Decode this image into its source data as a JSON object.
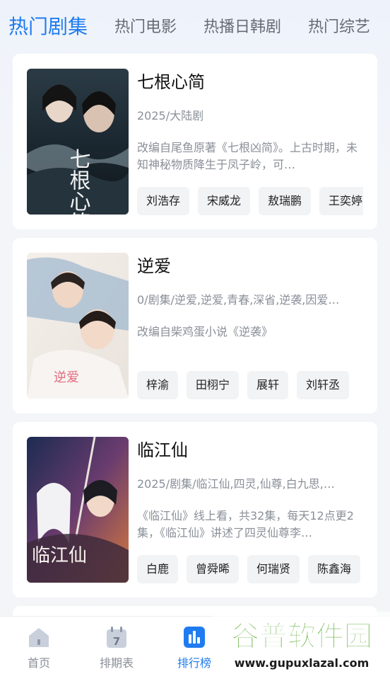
{
  "tabs": [
    {
      "label": "热门剧集",
      "active": true
    },
    {
      "label": "热门电影",
      "active": false
    },
    {
      "label": "热播日韩剧",
      "active": false
    },
    {
      "label": "热门综艺",
      "active": false
    }
  ],
  "cards": [
    {
      "title": "七根心简",
      "meta": "2025/大陆剧",
      "desc": "改编自尾鱼原著《七根凶简》。上古时期，未知神秘物质降生于凤子岭，可…",
      "tags": [
        "刘浩存",
        "宋威龙",
        "敖瑞鹏",
        "王奕婷"
      ],
      "poster_text": "七根心简"
    },
    {
      "title": "逆爱",
      "meta": "0/剧集/逆爱,逆爱,青春,深省,逆袭,因爱…",
      "desc": "改编自柴鸡蛋小说《逆袭》",
      "tags": [
        "梓渝",
        "田栩宁",
        "展轩",
        "刘轩丞"
      ],
      "poster_text": "逆爱"
    },
    {
      "title": "临江仙",
      "meta": "2025/剧集/临江仙,四灵,仙尊,白九思,…",
      "desc": "《临江仙》线上看，共32集，每天12点更2集，《临江仙》讲述了四灵仙尊李…",
      "tags": [
        "白鹿",
        "曾舜晞",
        "何瑞贤",
        "陈鑫海"
      ],
      "poster_text": "临江仙"
    }
  ],
  "nav": [
    {
      "label": "首页",
      "icon": "home-icon",
      "active": false
    },
    {
      "label": "排期表",
      "icon": "calendar-icon",
      "active": false
    },
    {
      "label": "排行榜",
      "icon": "bar-chart-icon",
      "active": true
    }
  ],
  "calendar_day": "7",
  "watermark": {
    "brand": "谷普软件园",
    "url": "www.gupuxlazal.com"
  },
  "colors": {
    "accent": "#1f7cf0",
    "muted": "#8a8f98",
    "watermark_green": "#5fae3a"
  }
}
